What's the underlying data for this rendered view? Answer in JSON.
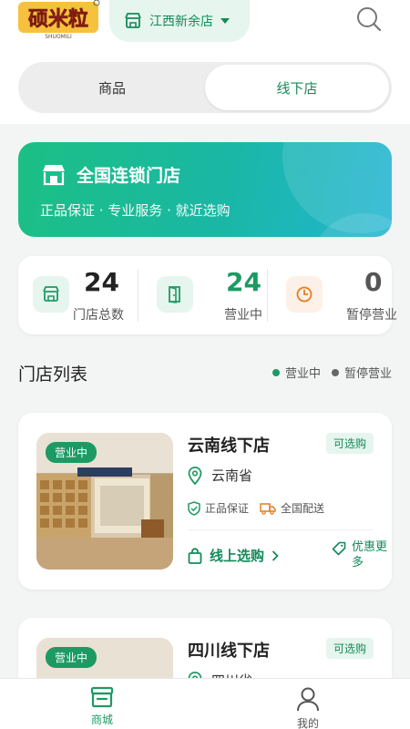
{
  "header": {
    "logo_text": "硕米粒",
    "logo_sub": "SHUOMILI",
    "store_name": "江西新余店"
  },
  "tabs": [
    {
      "label": "商品",
      "active": false
    },
    {
      "label": "线下店",
      "active": true
    }
  ],
  "hero": {
    "title": "全国连锁门店",
    "subtitle": "正品保证 · 专业服务 · 就近选购"
  },
  "stats": [
    {
      "value": "24",
      "label": "门店总数",
      "color": "#222222",
      "icon": "store-icon"
    },
    {
      "value": "24",
      "label": "营业中",
      "color": "#1d9a64",
      "icon": "door-icon"
    },
    {
      "value": "0",
      "label": "暂停营业",
      "color": "#555555",
      "icon": "clock-icon"
    }
  ],
  "list": {
    "title": "门店列表",
    "legend": [
      {
        "label": "营业中",
        "color": "#1d9a64"
      },
      {
        "label": "暂停营业",
        "color": "#666666"
      }
    ]
  },
  "stores": [
    {
      "name": "云南线下店",
      "status": "营业中",
      "tag": "可选购",
      "location": "云南省",
      "features": [
        "正品保证",
        "全国配送"
      ],
      "action": "线上选购",
      "promo": "优惠更多"
    },
    {
      "name": "四川线下店",
      "status": "营业中",
      "tag": "可选购",
      "location": "四川省"
    }
  ],
  "bottom_nav": [
    {
      "label": "商城",
      "active": true
    },
    {
      "label": "我的",
      "active": false
    }
  ],
  "colors": {
    "brand_green": "#1d9a64",
    "hero_gradient_start": "#1cbf84",
    "hero_gradient_end": "#22b6d3"
  }
}
